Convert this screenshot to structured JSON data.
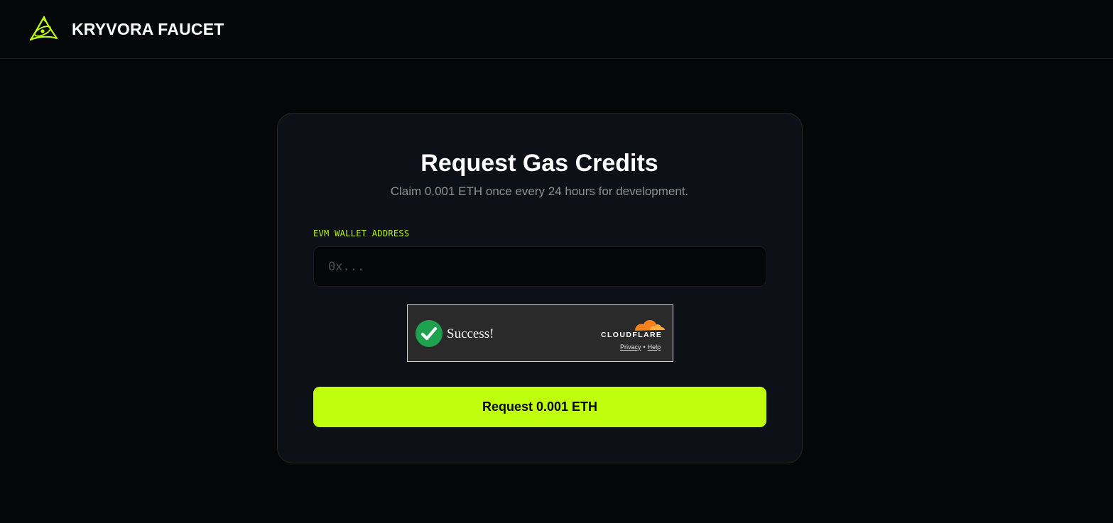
{
  "header": {
    "brand_name": "KRYVORA FAUCET",
    "logo_icon": "orbit-atom-icon",
    "accent_color": "#bfff0e"
  },
  "card": {
    "title": "Request Gas Credits",
    "subtitle": "Claim 0.001 ETH once every 24 hours for development."
  },
  "wallet": {
    "label": "EVM WALLET ADDRESS",
    "value": "",
    "placeholder": "0x..."
  },
  "captcha": {
    "status": "Success!",
    "status_icon": "checkmark-icon",
    "provider": "CLOUDFLARE",
    "privacy_label": "Privacy",
    "separator": "•",
    "help_label": "Help",
    "success_color": "#1fa24f",
    "provider_color": "#f48120"
  },
  "submit": {
    "label": "Request 0.001 ETH"
  }
}
